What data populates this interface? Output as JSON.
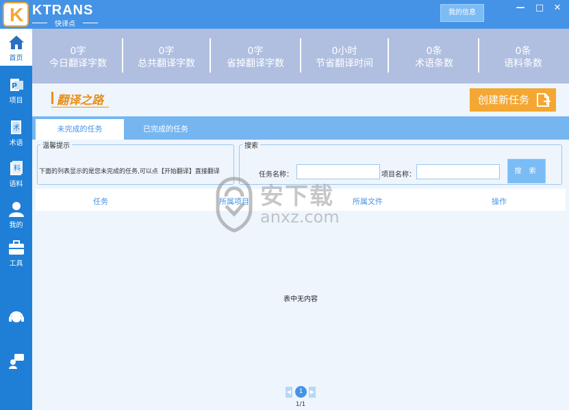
{
  "app": {
    "logo_letter": "K",
    "brand": "KTRANS",
    "brand_sub": "快译点",
    "my_info_label": "我的信息",
    "window_controls": [
      "minimize-icon",
      "maximize-icon",
      "close-icon"
    ]
  },
  "sidebar": {
    "items": [
      {
        "label": "首页",
        "icon": "home-icon",
        "active": true
      },
      {
        "label": "项目",
        "icon": "project-icon",
        "active": false
      },
      {
        "label": "术语",
        "icon": "terminology-icon",
        "active": false
      },
      {
        "label": "语料",
        "icon": "corpus-icon",
        "active": false
      },
      {
        "label": "我的",
        "icon": "user-icon",
        "active": false
      },
      {
        "label": "工具",
        "icon": "toolbox-icon",
        "active": false
      }
    ],
    "bottom_icons": [
      "customer-service-icon",
      "feedback-icon"
    ]
  },
  "stats": [
    {
      "value": "0字",
      "label": "今日翻译字数"
    },
    {
      "value": "0字",
      "label": "总共翻译字数"
    },
    {
      "value": "0字",
      "label": "省掉翻译字数"
    },
    {
      "value": "0小时",
      "label": "节省翻译时间"
    },
    {
      "value": "0条",
      "label": "术语条数"
    },
    {
      "value": "0条",
      "label": "语料条数"
    }
  ],
  "banner": {
    "slogan": "翻译之路",
    "create_task_label": "创建新任务"
  },
  "tabs": [
    {
      "label": "未完成的任务",
      "active": true
    },
    {
      "label": "已完成的任务",
      "active": false
    }
  ],
  "tip": {
    "legend": "温馨提示",
    "text": "下面的列表显示的是您未完成的任务,可以点【开始翻译】直接翻译"
  },
  "search": {
    "legend": "搜索",
    "task_name_label": "任务名称：",
    "task_name_value": "",
    "project_name_label": "项目名称：",
    "project_name_value": "",
    "button_label": "搜 索"
  },
  "table": {
    "columns": [
      "任务",
      "所属项目",
      "所属文件",
      "操作"
    ],
    "rows": [],
    "empty_message": "表中无内容"
  },
  "pagination": {
    "prev": "◀",
    "next": "▶",
    "current": "1",
    "info": "1/1"
  },
  "watermark": {
    "text": "安下载",
    "sub": "anxz.com"
  },
  "colors": {
    "titlebar": "#4593e6",
    "sidebar": "#1f7fd6",
    "accent_orange": "#f4a733",
    "tab_bar": "#76b6f0"
  }
}
